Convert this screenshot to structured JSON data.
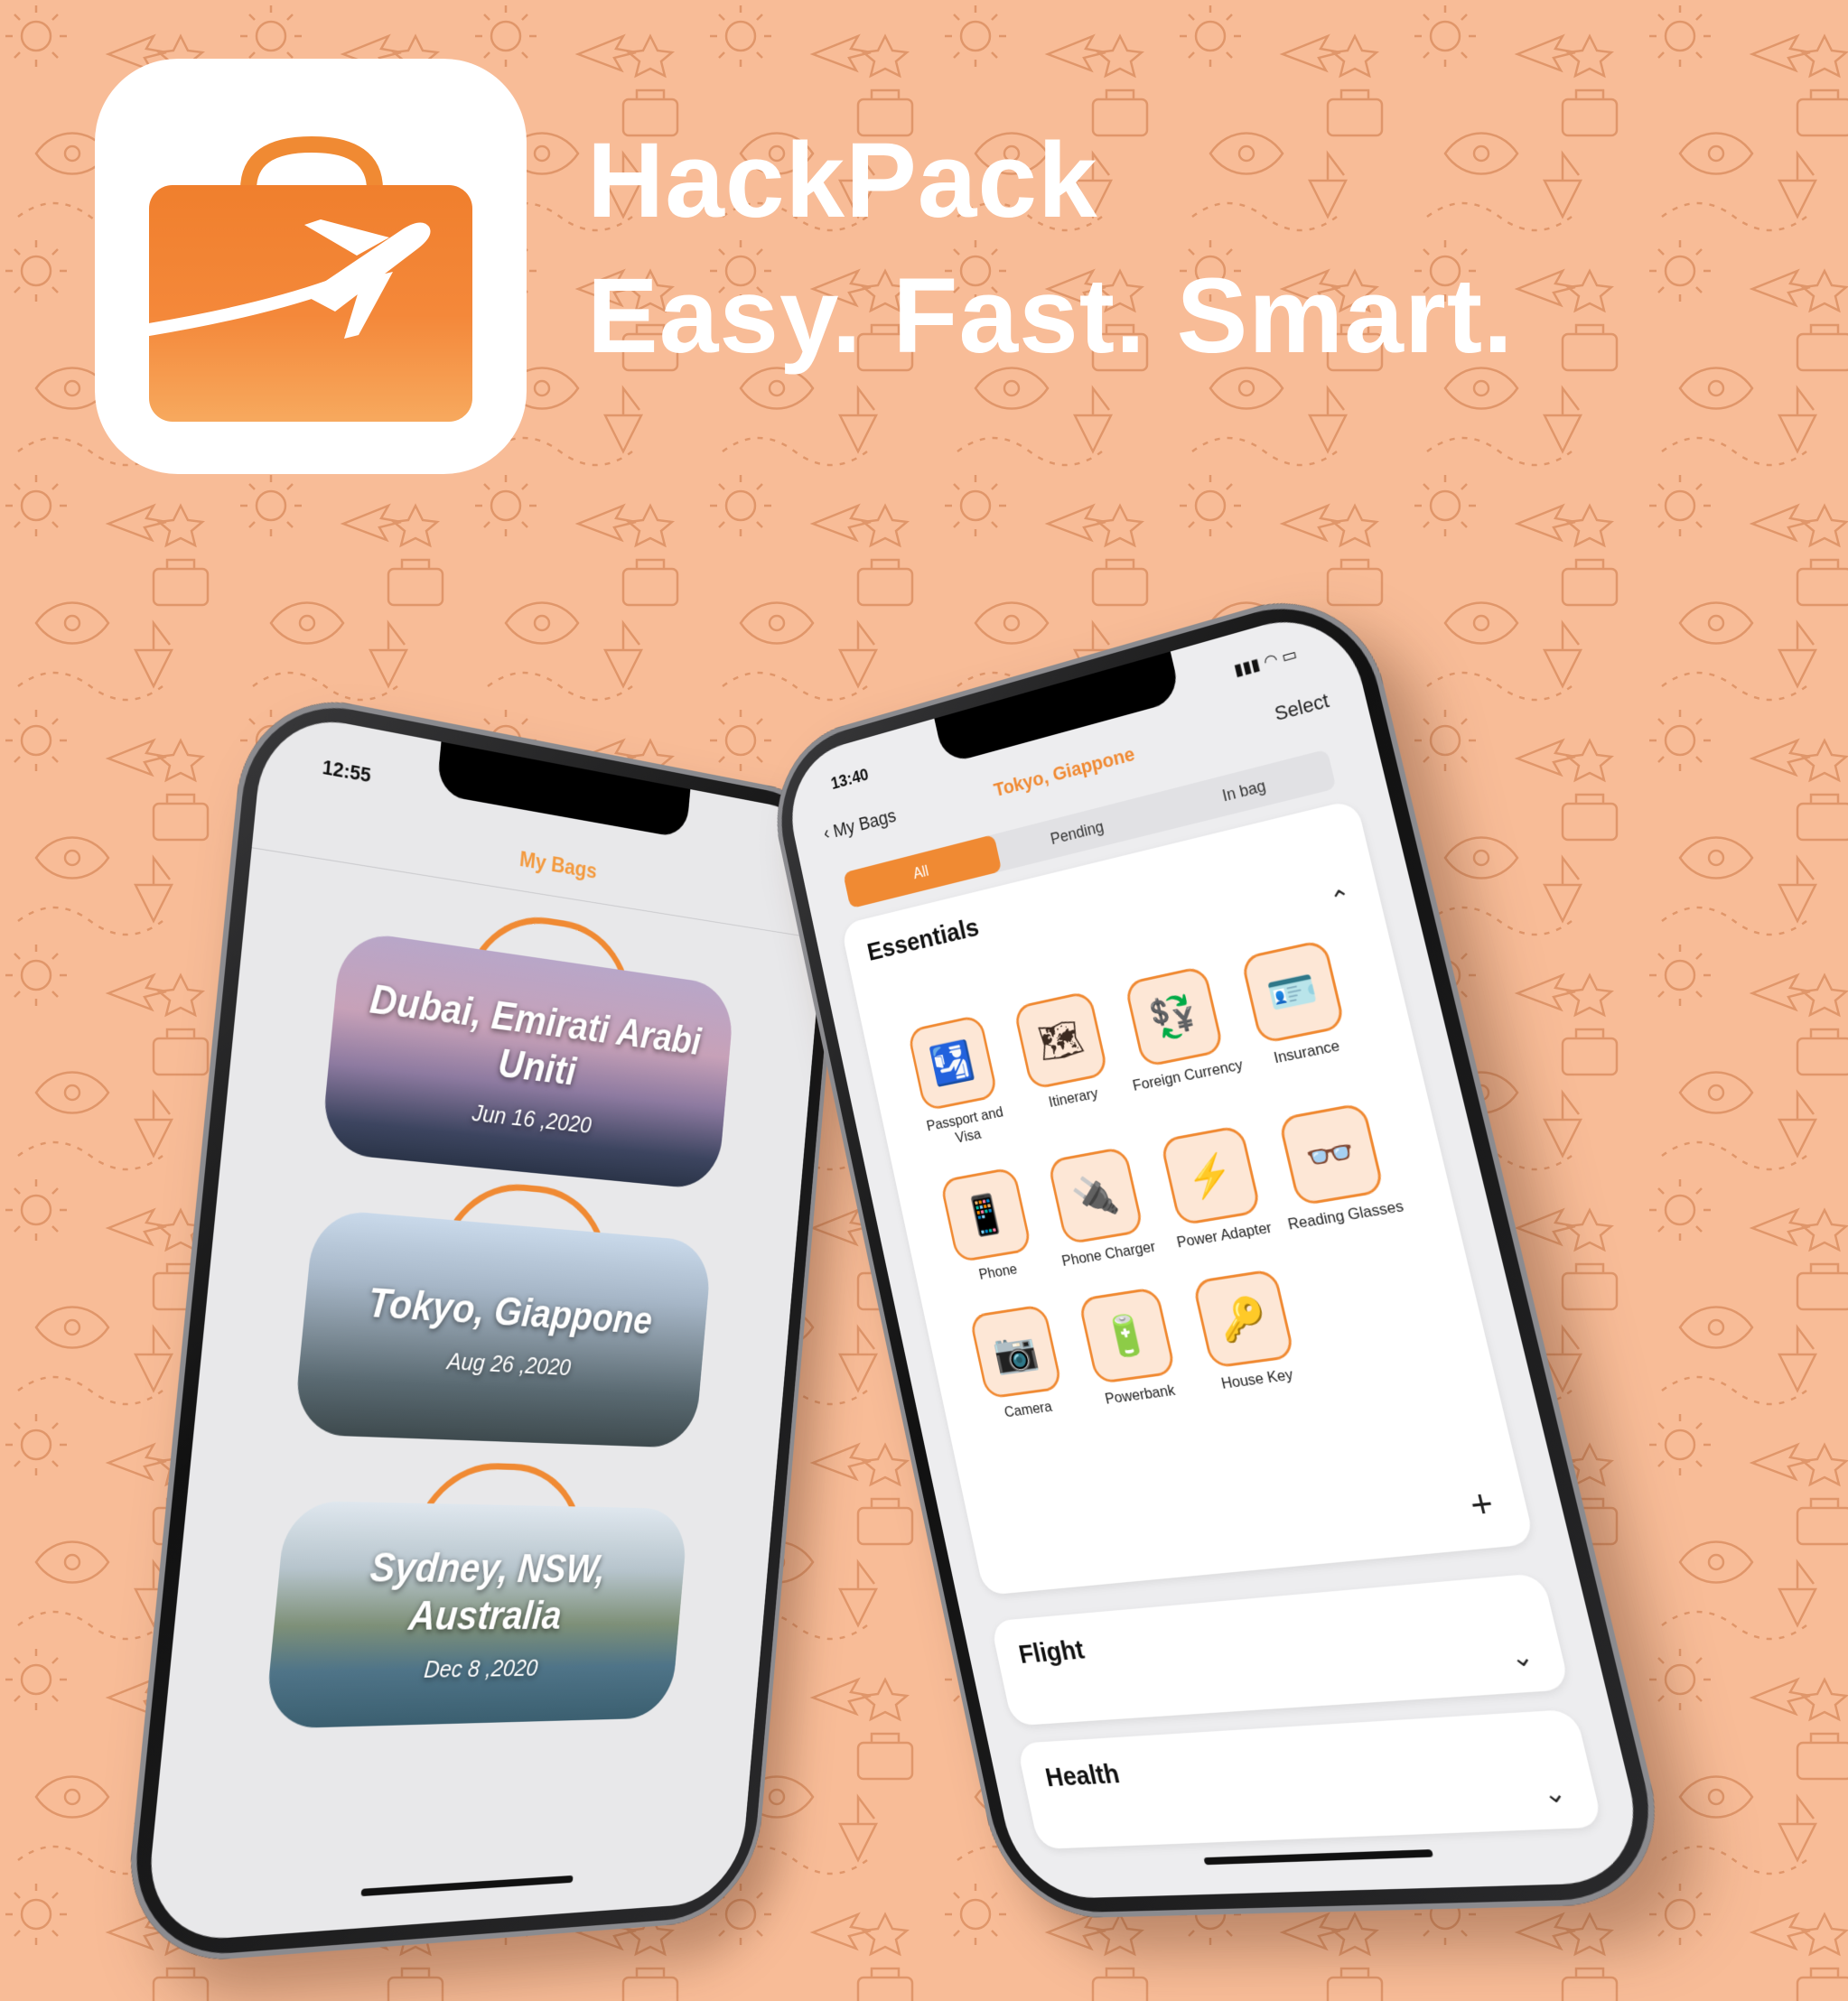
{
  "brand": {
    "app_name": "HackPack",
    "tagline": "Easy. Fast. Smart.",
    "colors": {
      "accent": "#f08a33",
      "background": "#f8bc97",
      "text_on_bg": "#ffffff"
    }
  },
  "phone_bags": {
    "status_time": "12:55",
    "nav_title": "My Bags",
    "bags": [
      {
        "city": "Dubai, Emirati Arabi Uniti",
        "date": "Jun 16 ,2020"
      },
      {
        "city": "Tokyo, Giappone",
        "date": "Aug 26 ,2020"
      },
      {
        "city": "Sydney, NSW, Australia",
        "date": "Dec 8 ,2020"
      }
    ]
  },
  "phone_detail": {
    "status_time": "13:40",
    "back_label": "My Bags",
    "title": "Tokyo, Giappone",
    "select_label": "Select",
    "segments": [
      "All",
      "Pending",
      "In bag"
    ],
    "sections": {
      "essentials": {
        "title": "Essentials",
        "items": [
          {
            "label": "Passport and Visa",
            "icon": "passport-icon"
          },
          {
            "label": "Itinerary",
            "icon": "itinerary-icon"
          },
          {
            "label": "Foreign Currency",
            "icon": "currency-icon"
          },
          {
            "label": "Insurance",
            "icon": "insurance-icon"
          },
          {
            "label": "Phone",
            "icon": "phone-icon"
          },
          {
            "label": "Phone Charger",
            "icon": "charger-icon"
          },
          {
            "label": "Power Adapter",
            "icon": "adapter-icon"
          },
          {
            "label": "Reading Glasses",
            "icon": "glasses-icon"
          },
          {
            "label": "Camera",
            "icon": "camera-icon"
          },
          {
            "label": "Powerbank",
            "icon": "powerbank-icon"
          },
          {
            "label": "House Key",
            "icon": "key-icon"
          }
        ]
      },
      "flight": {
        "title": "Flight"
      },
      "health": {
        "title": "Health"
      }
    }
  }
}
